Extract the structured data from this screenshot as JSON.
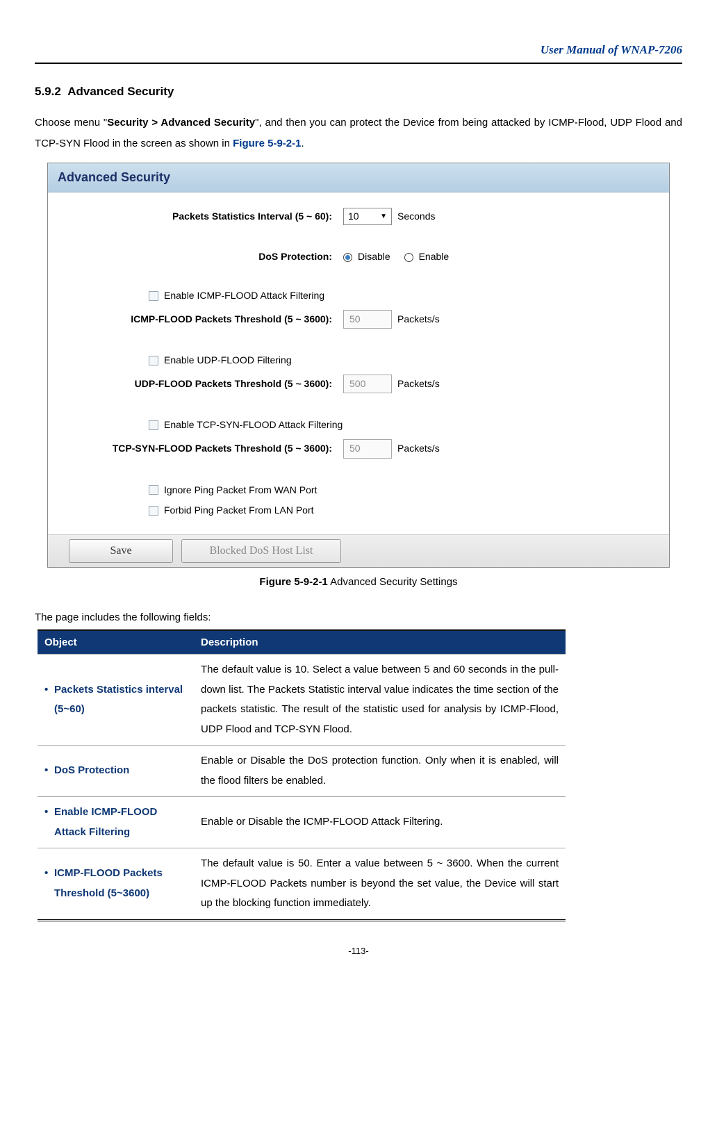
{
  "header": {
    "title": "User Manual of WNAP-7206"
  },
  "section": {
    "number": "5.9.2",
    "title": "Advanced Security"
  },
  "intro": {
    "pre": "Choose menu \"",
    "menu": "Security > Advanced Security",
    "mid": "\", and then you can protect the Device from being attacked by ICMP-Flood, UDP Flood and TCP-SYN Flood in the screen as shown in ",
    "figref": "Figure 5-9-2-1",
    "post": "."
  },
  "shot": {
    "title": "Advanced Security",
    "stats_label": "Packets Statistics Interval (5 ~ 60):",
    "stats_value": "10",
    "stats_unit": "Seconds",
    "dos_label": "DoS Protection:",
    "dos_disable": "Disable",
    "dos_enable": "Enable",
    "icmp_enable": "Enable ICMP-FLOOD Attack Filtering",
    "icmp_thresh_label": "ICMP-FLOOD Packets Threshold (5 ~ 3600):",
    "icmp_thresh_value": "50",
    "udp_enable": "Enable UDP-FLOOD Filtering",
    "udp_thresh_label": "UDP-FLOOD Packets Threshold (5 ~ 3600):",
    "udp_thresh_value": "500",
    "tcp_enable": "Enable TCP-SYN-FLOOD Attack Filtering",
    "tcp_thresh_label": "TCP-SYN-FLOOD Packets Threshold (5 ~ 3600):",
    "tcp_thresh_value": "50",
    "unit_ps": "Packets/s",
    "ignore_wan": "Ignore Ping Packet From WAN Port",
    "forbid_lan": "Forbid Ping Packet From LAN Port",
    "save_btn": "Save",
    "blocked_btn": "Blocked DoS Host List"
  },
  "figcaption": {
    "bold": "Figure 5-9-2-1",
    "rest": " Advanced Security Settings"
  },
  "fields_intro": "The page includes the following fields:",
  "table": {
    "h1": "Object",
    "h2": "Description",
    "rows": [
      {
        "obj": "Packets Statistics interval (5~60)",
        "desc": "The default value is 10. Select a value between 5 and 60 seconds in the pull-down list. The Packets Statistic interval value indicates the time section of the packets statistic. The result of the statistic used for analysis by ICMP-Flood, UDP Flood and TCP-SYN Flood."
      },
      {
        "obj": "DoS Protection",
        "desc": "Enable or Disable the DoS protection function. Only when it is enabled, will the flood filters be enabled."
      },
      {
        "obj": "Enable ICMP-FLOOD Attack Filtering",
        "desc": "Enable or Disable the ICMP-FLOOD Attack Filtering."
      },
      {
        "obj": "ICMP-FLOOD Packets Threshold (5~3600)",
        "desc": "The default value is 50. Enter a value between 5 ~ 3600. When the current ICMP-FLOOD Packets number is beyond the set value, the Device will start up the blocking function immediately."
      }
    ]
  },
  "page_num": "-113-"
}
